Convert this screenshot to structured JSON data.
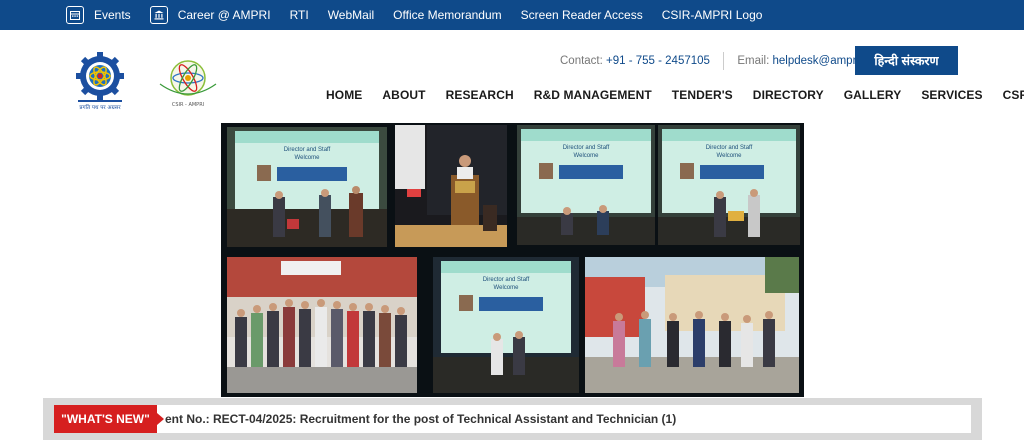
{
  "topbar": {
    "events": "Events",
    "career": "Career @ AMPRI",
    "rti": "RTI",
    "webmail": "WebMail",
    "office_memo": "Office Memorandum",
    "screen_reader": "Screen Reader Access",
    "csir_logo": "CSIR-AMPRI Logo"
  },
  "header": {
    "contact_label": "Contact:",
    "contact_value": "+91 - 755 - 2457105",
    "email_label": "Email:",
    "email_value": "helpdesk@ampri.res.in",
    "hindi_button": "हिन्दी संस्करण",
    "logo1_caption": "प्रगति पथ पर अग्रसर",
    "logo2_caption": "CSIR - AMPRI"
  },
  "nav": [
    "HOME",
    "ABOUT",
    "RESEARCH",
    "R&D MANAGEMENT",
    "TENDER'S",
    "DIRECTORY",
    "GALLERY",
    "SERVICES",
    "CSR"
  ],
  "ticker": {
    "label": "\"WHAT'S NEW\"",
    "text": "ent No.: RECT-04/2025:  Recruitment for the post of Technical Assistant and Technician (1)"
  },
  "banner": {
    "slide_heading": "Director and Staff",
    "slide_welcome": "Welcome"
  },
  "colors": {
    "primary": "#0f4a8a",
    "accent_red": "#d61f1f",
    "banner_bg": "#0a1014"
  }
}
